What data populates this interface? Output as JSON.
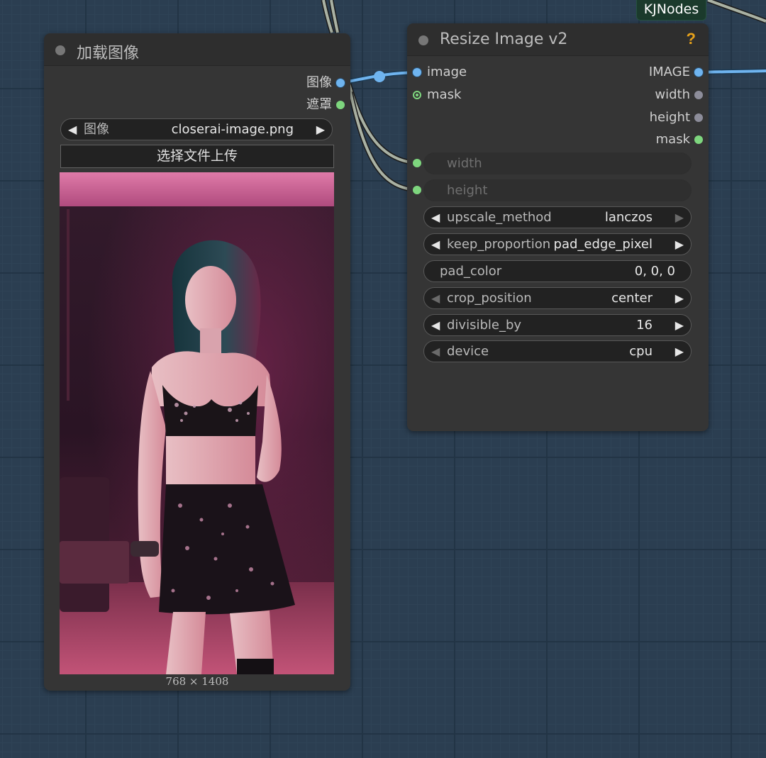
{
  "badge": {
    "label": "KJNodes"
  },
  "load_node": {
    "title": "加载图像",
    "outputs": [
      {
        "label": "图像",
        "color": "#6fb4ef"
      },
      {
        "label": "遮罩",
        "color": "#7ed67e"
      }
    ],
    "image_widget": {
      "label": "图像",
      "value": "closerai-image.png"
    },
    "upload_button": "选择文件上传",
    "image_size": "768 × 1408"
  },
  "resize_node": {
    "title": "Resize Image v2",
    "help": "?",
    "inputs": [
      {
        "label": "image"
      },
      {
        "label": "mask"
      }
    ],
    "outputs": [
      {
        "label": "IMAGE"
      },
      {
        "label": "width"
      },
      {
        "label": "height"
      },
      {
        "label": "mask"
      }
    ],
    "converted_inputs": [
      {
        "label": "width"
      },
      {
        "label": "height"
      }
    ],
    "widgets": [
      {
        "label": "upscale_method",
        "value": "lanczos"
      },
      {
        "label": "keep_proportion",
        "value": "pad_edge_pixel"
      },
      {
        "label": "pad_color",
        "value": "0, 0, 0"
      },
      {
        "label": "crop_position",
        "value": "center"
      },
      {
        "label": "divisible_by",
        "value": "16"
      },
      {
        "label": "device",
        "value": "cpu"
      }
    ]
  },
  "colors": {
    "canvas": "#2b3e51",
    "node": "#353535",
    "image_link": "#6fb4ef",
    "grey_link": "#a5ad9f"
  }
}
